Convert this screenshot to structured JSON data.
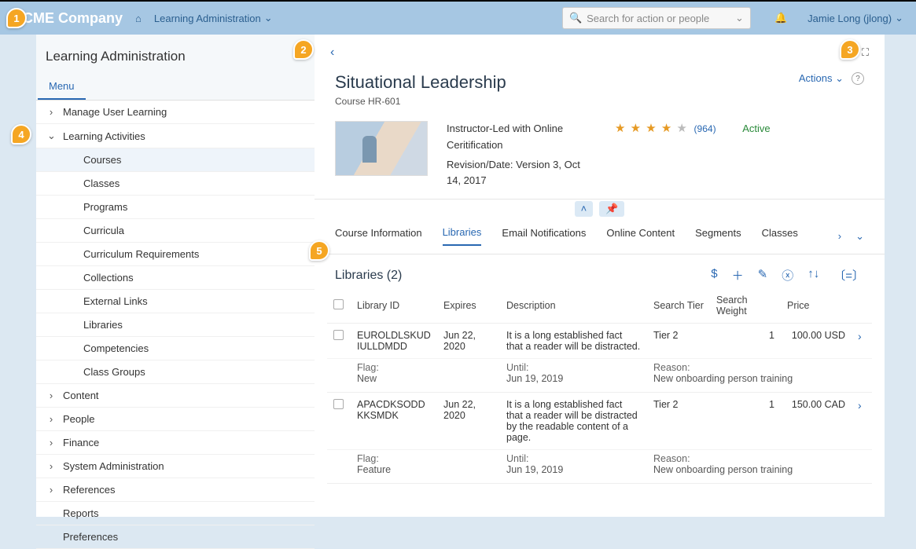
{
  "header": {
    "company": "ACME Company",
    "nav_label": "Learning Administration",
    "search_placeholder": "Search for action or people",
    "user": "Jamie Long (jlong)"
  },
  "sidebar": {
    "title": "Learning Administration",
    "menu_tab": "Menu",
    "items": [
      {
        "label": "Manage User Learning",
        "expandable": true,
        "expanded": false
      },
      {
        "label": "Learning Activities",
        "expandable": true,
        "expanded": true,
        "children": [
          {
            "label": "Courses",
            "active": true
          },
          {
            "label": "Classes"
          },
          {
            "label": "Programs"
          },
          {
            "label": "Curricula"
          },
          {
            "label": "Curriculum Requirements"
          },
          {
            "label": "Collections"
          },
          {
            "label": "External Links"
          },
          {
            "label": "Libraries"
          },
          {
            "label": "Competencies"
          },
          {
            "label": "Class Groups"
          }
        ]
      },
      {
        "label": "Content",
        "expandable": true
      },
      {
        "label": "People",
        "expandable": true
      },
      {
        "label": "Finance",
        "expandable": true
      },
      {
        "label": "System Administration",
        "expandable": true
      },
      {
        "label": "References",
        "expandable": true
      },
      {
        "label": "Reports"
      },
      {
        "label": "Preferences"
      }
    ]
  },
  "course": {
    "title": "Situational Leadership",
    "subtitle": "Course HR-601",
    "type": "Instructor-Led with Online Ceritification",
    "revision": "Revision/Date: Version 3, Oct 14, 2017",
    "rating_count": "(964)",
    "status": "Active",
    "actions_label": "Actions"
  },
  "tabs": {
    "items": [
      "Course Information",
      "Libraries",
      "Email Notifications",
      "Online Content",
      "Segments",
      "Classes"
    ],
    "active_index": 1
  },
  "libraries": {
    "title": "Libraries (2)",
    "columns": [
      "Library ID",
      "Expires",
      "Description",
      "Search Tier",
      "Search Weight",
      "Price"
    ],
    "subfields": {
      "flag": "Flag:",
      "until": "Until:",
      "reason": "Reason:"
    },
    "rows": [
      {
        "id": "EUROLDLSKUDIULLDMDD",
        "expires": "Jun 22, 2020",
        "description": "It is a long established fact that a reader will be distracted.",
        "tier": "Tier 2",
        "weight": "1",
        "price": "100.00 USD",
        "flag": "New",
        "until": "Jun 19, 2019",
        "reason": "New onboarding person training"
      },
      {
        "id": "APACDKSODDKKSMDK",
        "expires": "Jun 22, 2020",
        "description": "It is a long established fact that a reader will be distracted by the readable content of a page.",
        "tier": "Tier 2",
        "weight": "1",
        "price": "150.00 CAD",
        "flag": "Feature",
        "until": "Jun 19, 2019",
        "reason": "New onboarding person training"
      }
    ]
  },
  "callouts": [
    "1",
    "2",
    "3",
    "4",
    "5"
  ]
}
